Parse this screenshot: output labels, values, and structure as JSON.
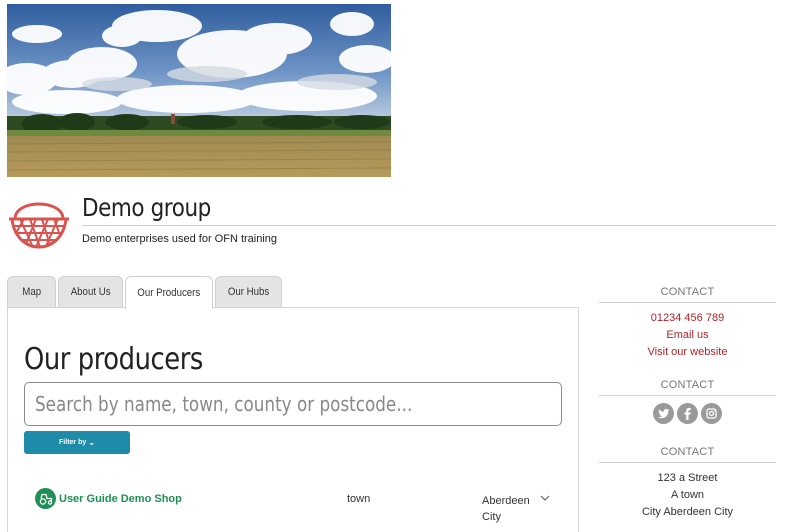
{
  "group": {
    "title": "Demo group",
    "description": "Demo enterprises used for OFN training"
  },
  "tabs": [
    {
      "label": "Map",
      "active": false
    },
    {
      "label": "About Us",
      "active": false
    },
    {
      "label": "Our Producers",
      "active": true
    },
    {
      "label": "Our Hubs",
      "active": false
    }
  ],
  "main": {
    "title": "Our producers",
    "search_placeholder": "Search by name, town, county or postcode...",
    "filter_label": "Filter by",
    "producers": [
      {
        "name": "User Guide Demo Shop",
        "town": "town",
        "region": "Aberdeen City",
        "icon": "tractor-icon"
      }
    ]
  },
  "sidebar": {
    "contact_heading": "CONTACT",
    "phone": "01234 456 789",
    "email_label": "Email us",
    "website_label": "Visit our website",
    "social_heading": "CONTACT",
    "social": [
      "twitter-icon",
      "facebook-icon",
      "instagram-icon"
    ],
    "address_heading": "CONTACT",
    "address": [
      "123 a Street",
      "A town",
      "City Aberdeen City"
    ]
  },
  "colors": {
    "accent": "#1e8ba8",
    "producer_green": "#1e8f55",
    "link_red": "#b5222a",
    "logo_red": "#d9534f"
  }
}
